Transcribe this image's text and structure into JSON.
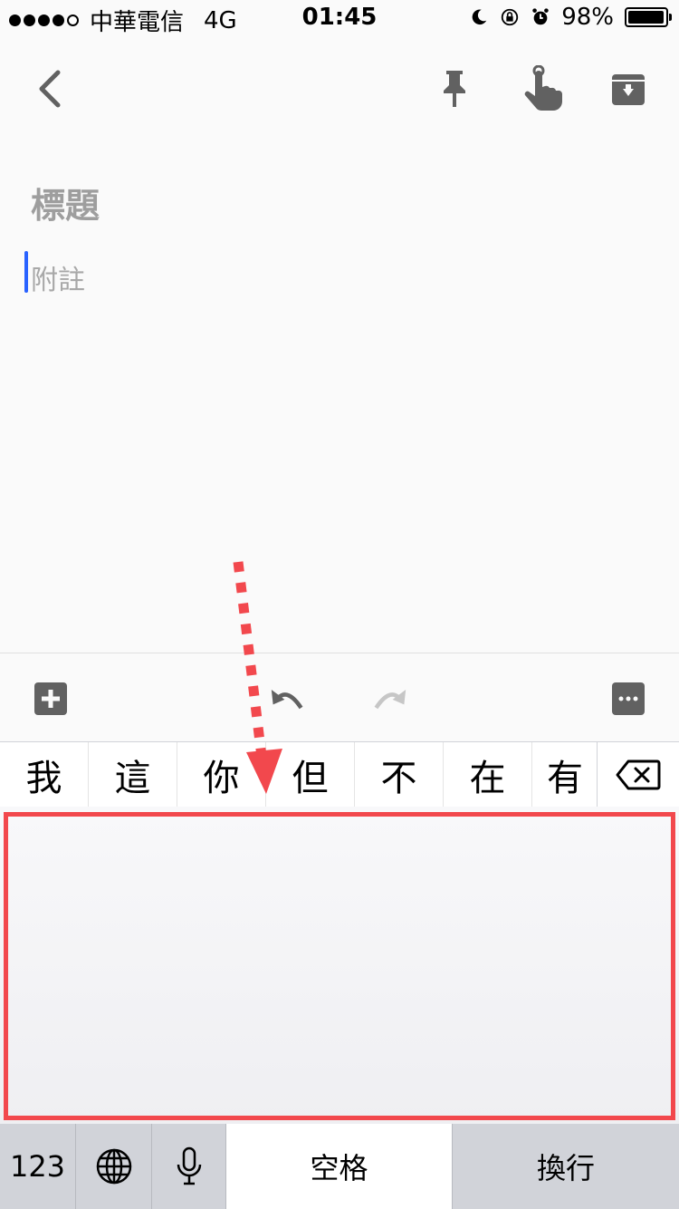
{
  "status_bar": {
    "signal_dots_filled": 4,
    "signal_dots_total": 5,
    "carrier": "中華電信",
    "network": "4G",
    "time": "01:45",
    "battery_percent": "98%",
    "battery_level": 0.98
  },
  "toolbar": {
    "back_icon": "chevron-left-icon",
    "pin_icon": "pin-icon",
    "reminder_icon": "reminder-finger-icon",
    "archive_icon": "archive-icon"
  },
  "note": {
    "title_placeholder": "標題",
    "body_placeholder": "附註"
  },
  "bottom_bar": {
    "add_icon": "plus-box-icon",
    "undo_icon": "undo-icon",
    "redo_icon": "redo-icon",
    "more_icon": "more-icon"
  },
  "candidates": [
    "我",
    "這",
    "你",
    "但",
    "不",
    "在",
    "有"
  ],
  "keyboard": {
    "numbers_label": "123",
    "space_label": "空格",
    "return_label": "換行"
  },
  "colors": {
    "highlight": "#f2484d",
    "caret": "#2962ff",
    "icon_gray": "#616161"
  }
}
